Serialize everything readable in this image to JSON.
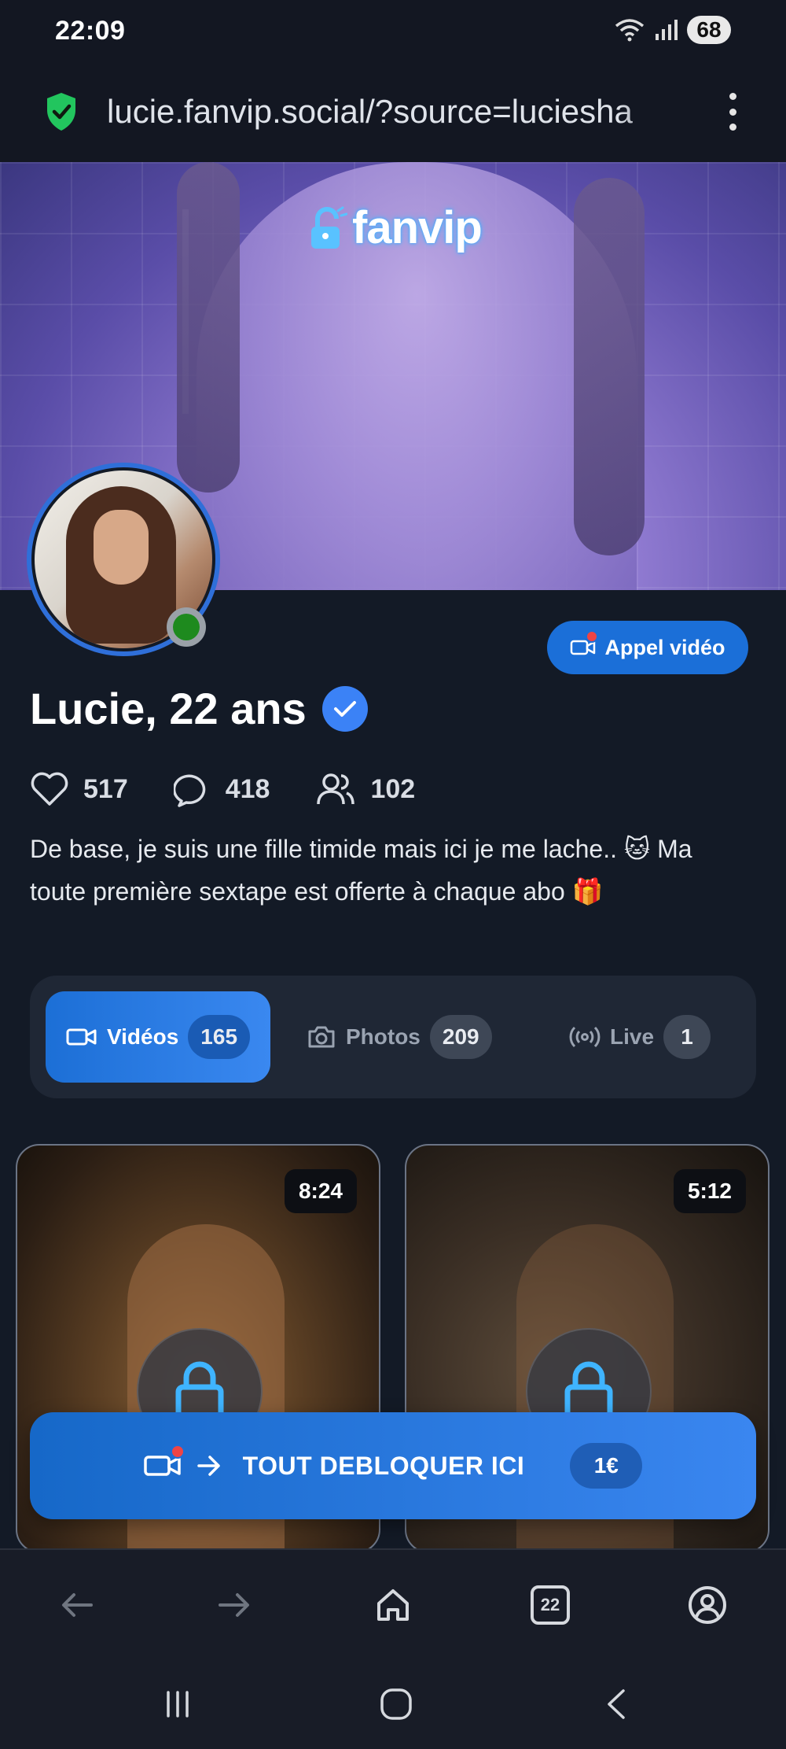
{
  "status_bar": {
    "time": "22:09",
    "battery": "68"
  },
  "browser": {
    "url": "lucie.fanvip.social/?source=luciesha"
  },
  "cover": {
    "logo_text": "fanvip"
  },
  "profile": {
    "video_call_label": "Appel vidéo",
    "name": "Lucie, 22 ans",
    "stats": {
      "likes": "517",
      "comments": "418",
      "subscribers": "102"
    },
    "bio": "De base, je suis une fille timide mais ici je me lache.. 🐱 Ma toute première sextape est offerte à chaque abo 🎁"
  },
  "tabs": [
    {
      "label": "Vidéos",
      "count": "165",
      "icon": "video-icon",
      "active": true
    },
    {
      "label": "Photos",
      "count": "209",
      "icon": "camera-icon",
      "active": false
    },
    {
      "label": "Live",
      "count": "1",
      "icon": "broadcast-icon",
      "active": false
    }
  ],
  "videos": [
    {
      "duration": "8:24",
      "locked": true
    },
    {
      "duration": "5:12",
      "locked": true
    }
  ],
  "unlock_banner": {
    "label": "TOUT DEBLOQUER ICI",
    "price": "1€"
  },
  "browser_nav": {
    "tab_count": "22"
  },
  "colors": {
    "accent": "#3b82f6",
    "background": "#131a26",
    "online": "#1e8a1e",
    "notification": "#ef4444"
  }
}
